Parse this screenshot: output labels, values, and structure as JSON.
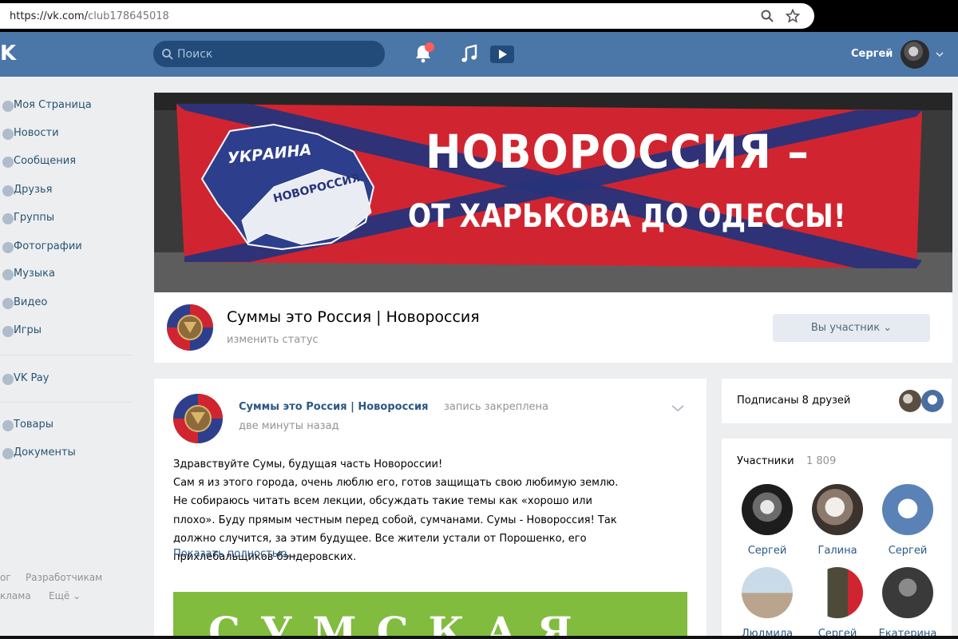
{
  "browser": {
    "url_host": "https://vk.com/",
    "url_path": "club178645018"
  },
  "header": {
    "logo": "K",
    "search_placeholder": "Поиск",
    "user_name": "Сергей"
  },
  "sidebar": {
    "items": [
      {
        "label": "Моя Страница"
      },
      {
        "label": "Новости"
      },
      {
        "label": "Сообщения"
      },
      {
        "label": "Друзья"
      },
      {
        "label": "Группы"
      },
      {
        "label": "Фотографии"
      },
      {
        "label": "Музыка"
      },
      {
        "label": "Видео"
      },
      {
        "label": "Игры"
      },
      {
        "label": "VK Pay"
      },
      {
        "label": "Товары"
      },
      {
        "label": "Документы"
      }
    ],
    "footer": {
      "blog": "ог",
      "developers": "Разработчикам",
      "ads": "клама",
      "more": "Ещё ⌄"
    }
  },
  "cover": {
    "map_label_1": "УКРАИНА",
    "map_label_2": "НОВОРОССИЯ",
    "headline": "НОВОРОССИЯ –",
    "subline": "ОТ ХАРЬКОВА ДО ОДЕССЫ!"
  },
  "group": {
    "name": "Суммы это Россия | Новороссия",
    "status": "изменить статус",
    "member_button": "Вы участник ⌄"
  },
  "post": {
    "author": "Суммы это Россия | Новороссия",
    "pinned": "запись закреплена",
    "time": "две минуты назад",
    "lines": [
      "Здравствуйте Сумы, будущая часть Новороссии!",
      "Сам я из этого города, очень люблю его, готов защищать свою любимую землю.",
      "Не собираюсь читать всем лекции, обсуждать такие темы как «хорошо или",
      "плохо». Буду прямым честным перед собой, сумчанами. Сумы - Новороссия! Так",
      "должно случится, за этим будущее. Все жители устали от Порошенко, его",
      "прихлебальщиков бэндеровских."
    ],
    "show_more": "Показать полностью...",
    "image_text": "СУМСКАЯ"
  },
  "friends": {
    "text": "Подписаны 8 друзей"
  },
  "members": {
    "title": "Участники",
    "count": "1 809",
    "list": [
      {
        "name": "Сергей"
      },
      {
        "name": "Галина"
      },
      {
        "name": "Сергей"
      },
      {
        "name": "Людмила"
      },
      {
        "name": "Сергей"
      },
      {
        "name": "Екатерина"
      }
    ]
  },
  "colors": {
    "header_blue": "#4a76a8",
    "page_bg": "#edeef0",
    "link_blue": "#2a5885",
    "banner_red": "#d02530",
    "banner_navy": "#26337a",
    "post_image_green": "#81bc3f"
  }
}
